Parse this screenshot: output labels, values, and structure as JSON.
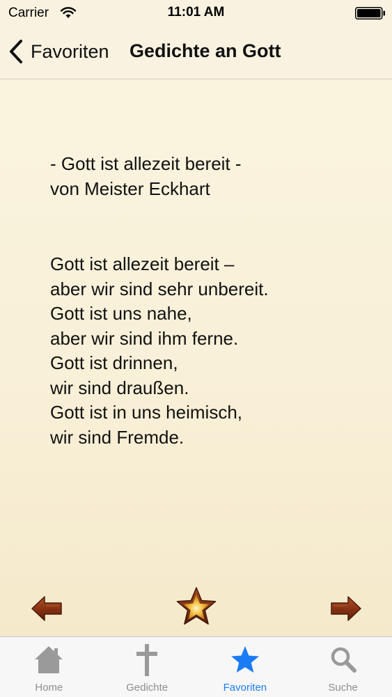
{
  "status_bar": {
    "carrier": "Carrier",
    "time": "11:01 AM",
    "icons": [
      "wifi-icon",
      "battery-icon"
    ]
  },
  "nav": {
    "back_label": "Favoriten",
    "title": "Gedichte an Gott"
  },
  "poem": {
    "header_lines": [
      "- Gott ist allezeit bereit -",
      "von Meister Eckhart"
    ],
    "lines": [
      "Gott ist allezeit bereit –",
      "aber wir sind sehr unbereit.",
      "Gott ist uns nahe,",
      "aber wir sind ihm ferne.",
      "Gott ist drinnen,",
      "wir sind draußen.",
      "Gott ist in uns heimisch,",
      "wir sind Fremde."
    ]
  },
  "controls": {
    "icons": [
      "arrow-left-icon",
      "star-icon",
      "arrow-right-icon"
    ],
    "favorite_active": true
  },
  "tabs": [
    {
      "label": "Home",
      "icon": "home-icon",
      "active": false
    },
    {
      "label": "Gedichte",
      "icon": "cross-icon",
      "active": false
    },
    {
      "label": "Favoriten",
      "icon": "star-icon",
      "active": true
    },
    {
      "label": "Suche",
      "icon": "search-icon",
      "active": false
    }
  ],
  "colors": {
    "background": "#faf4e1",
    "active_tab": "#1a7cf5",
    "inactive_tab": "#8e8e8e"
  }
}
